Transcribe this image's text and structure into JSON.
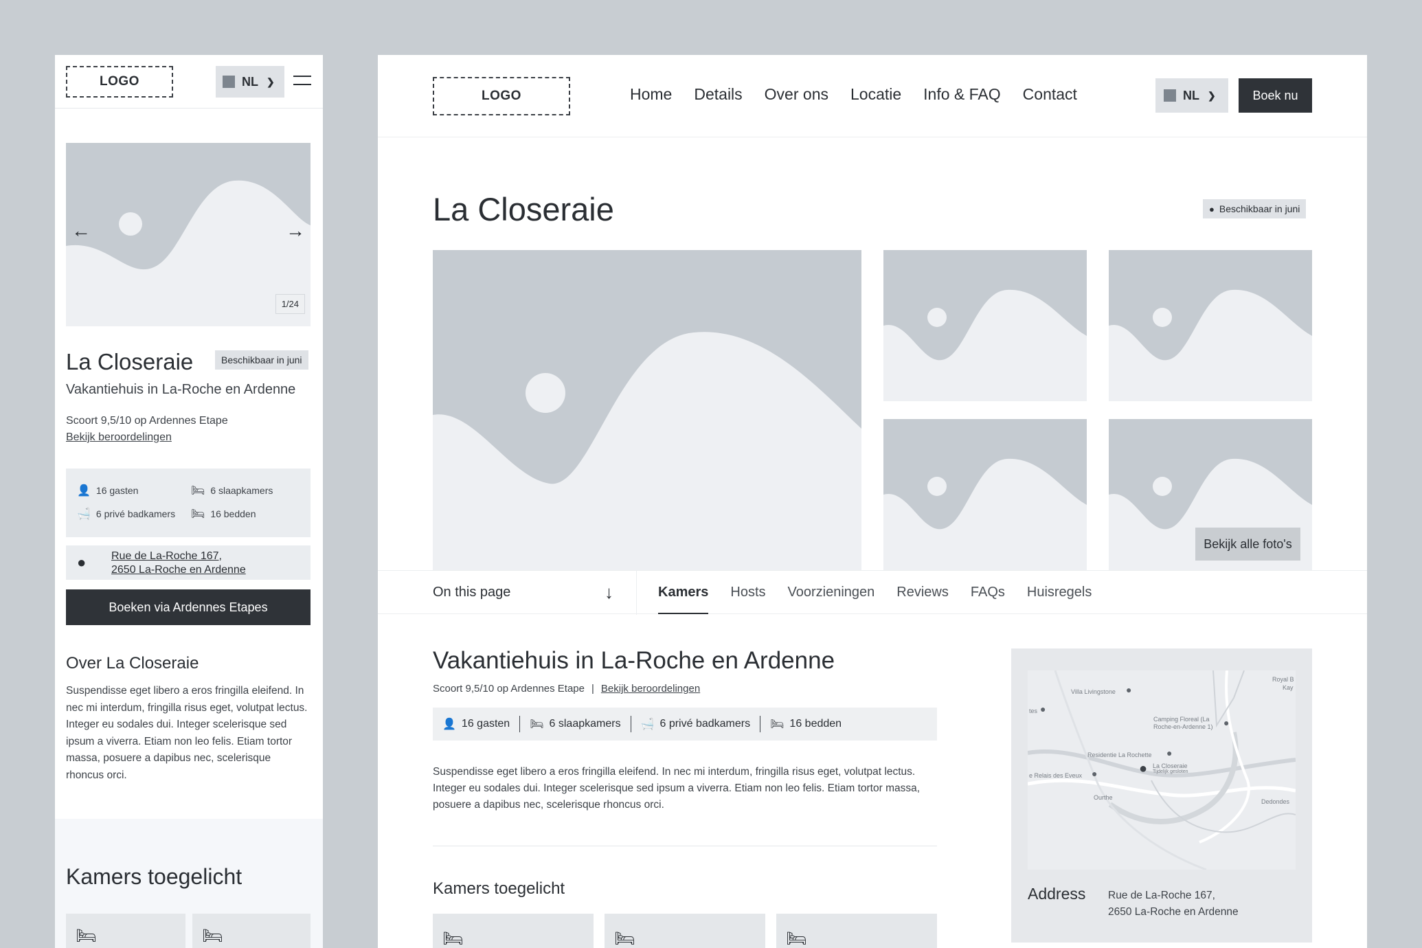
{
  "mobile": {
    "logo": "LOGO",
    "lang": "NL",
    "carousel_counter": "1/24",
    "title": "La Closeraie",
    "badge": "Beschikbaar in juni",
    "subtitle": "Vakantiehuis in La-Roche en Ardenne",
    "score": "Scoort 9,5/10 op Ardennes Etape",
    "reviews_link": "Bekijk beroordelingen",
    "specs": {
      "guests": "16 gasten",
      "bedrooms": "6 slaapkamers",
      "bathrooms": "6 privé badkamers",
      "beds": "16 bedden"
    },
    "address_line1": "Rue de La-Roche 167,",
    "address_line2": "2650 La-Roche en Ardenne",
    "book_button": "Boeken via Ardennes Etapes",
    "about_title": "Over La Closeraie",
    "about_text": "Suspendisse eget libero a eros fringilla eleifend. In nec mi interdum, fringilla risus eget, volutpat lectus. Integer eu sodales dui. Integer scelerisque sed ipsum a viverra. Etiam non leo felis. Etiam tortor massa, posuere a dapibus nec, scelerisque rhoncus orci.",
    "rooms_title": "Kamers toegelicht"
  },
  "desktop": {
    "logo": "LOGO",
    "nav": [
      "Home",
      "Details",
      "Over ons",
      "Locatie",
      "Info & FAQ",
      "Contact"
    ],
    "lang": "NL",
    "book_button": "Boek nu",
    "title": "La Closeraie",
    "badge": "Beschikbaar in juni",
    "all_photos": "Bekijk alle foto's",
    "on_this_page": "On this page",
    "tabs": [
      "Kamers",
      "Hosts",
      "Voorzieningen",
      "Reviews",
      "FAQs",
      "Huisregels"
    ],
    "section_title": "Vakantiehuis in La-Roche en Ardenne",
    "score": "Scoort 9,5/10 op Ardennes Etape",
    "score_sep": "|",
    "reviews_link": "Bekijk beroordelingen",
    "specs": {
      "guests": "16 gasten",
      "bedrooms": "6 slaapkamers",
      "bathrooms": "6 privé badkamers",
      "beds": "16 bedden"
    },
    "description": "Suspendisse eget libero a eros fringilla eleifend. In nec mi interdum, fringilla risus eget, volutpat lectus. Integer eu sodales dui. Integer scelerisque sed ipsum a viverra. Etiam non leo felis. Etiam tortor massa, posuere a dapibus nec, scelerisque rhoncus orci.",
    "rooms_title": "Kamers toegelicht",
    "map_labels": {
      "villa": "Villa Livingstone",
      "royal": "Royal B",
      "kay": "Kay",
      "tes": "tes",
      "camping1": "Camping Floreal (La",
      "camping2": "Roche-en-Ardenne 1)",
      "residentie": "Residentie La Rochette",
      "relais": "e Relais des Eveux",
      "closeraie1": "La Closeraie",
      "closeraie2": "Tijdelijk gesloten",
      "ourthe": "Ourthe",
      "dedondes": "Dedondes"
    },
    "address_label": "Address",
    "address_line1": "Rue de La-Roche 167,",
    "address_line2": "2650 La-Roche en Ardenne"
  },
  "icons": {
    "person": "person-icon",
    "bed": "bed-icon",
    "bath": "bath-icon",
    "pin": "pin-icon"
  },
  "colors": {
    "background": "#c8cdd2",
    "placeholder": "#c5cbd1",
    "placeholder_light": "#eef0f3",
    "dark_button": "#2f3338"
  }
}
